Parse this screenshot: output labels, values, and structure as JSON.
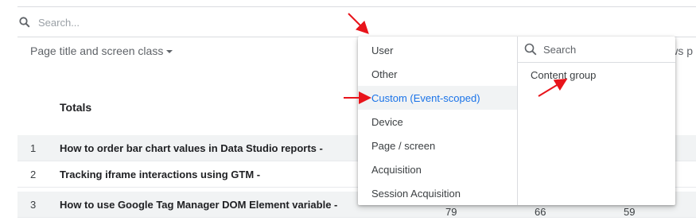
{
  "table": {
    "search_placeholder": "Search...",
    "dimension_header": "Page title and screen class",
    "right_header_fragment": "ws p",
    "totals_label": "Totals",
    "rows": [
      {
        "index": "1",
        "title": "How to order bar chart values in Data Studio reports -",
        "values": [
          "",
          "",
          ""
        ]
      },
      {
        "index": "2",
        "title": "Tracking iframe interactions using GTM -",
        "values": [
          "",
          "",
          ""
        ]
      },
      {
        "index": "3",
        "title": "How to use Google Tag Manager DOM Element variable -",
        "values": [
          "79",
          "66",
          "59"
        ]
      }
    ]
  },
  "dropdown": {
    "categories": [
      "User",
      "Other",
      "Custom (Event-scoped)",
      "Device",
      "Page / screen",
      "Acquisition",
      "Session Acquisition"
    ],
    "active_category": "Custom (Event-scoped)",
    "submenu_search_placeholder": "Search",
    "submenu_items": [
      "Content group"
    ]
  },
  "colors": {
    "accent_text": "#1a73e8",
    "annotation_arrow": "#e8141b",
    "row_highlight": "#f1f3f4"
  },
  "icons": [
    "search-icon",
    "caret-down-icon",
    "arrow-annotation"
  ]
}
